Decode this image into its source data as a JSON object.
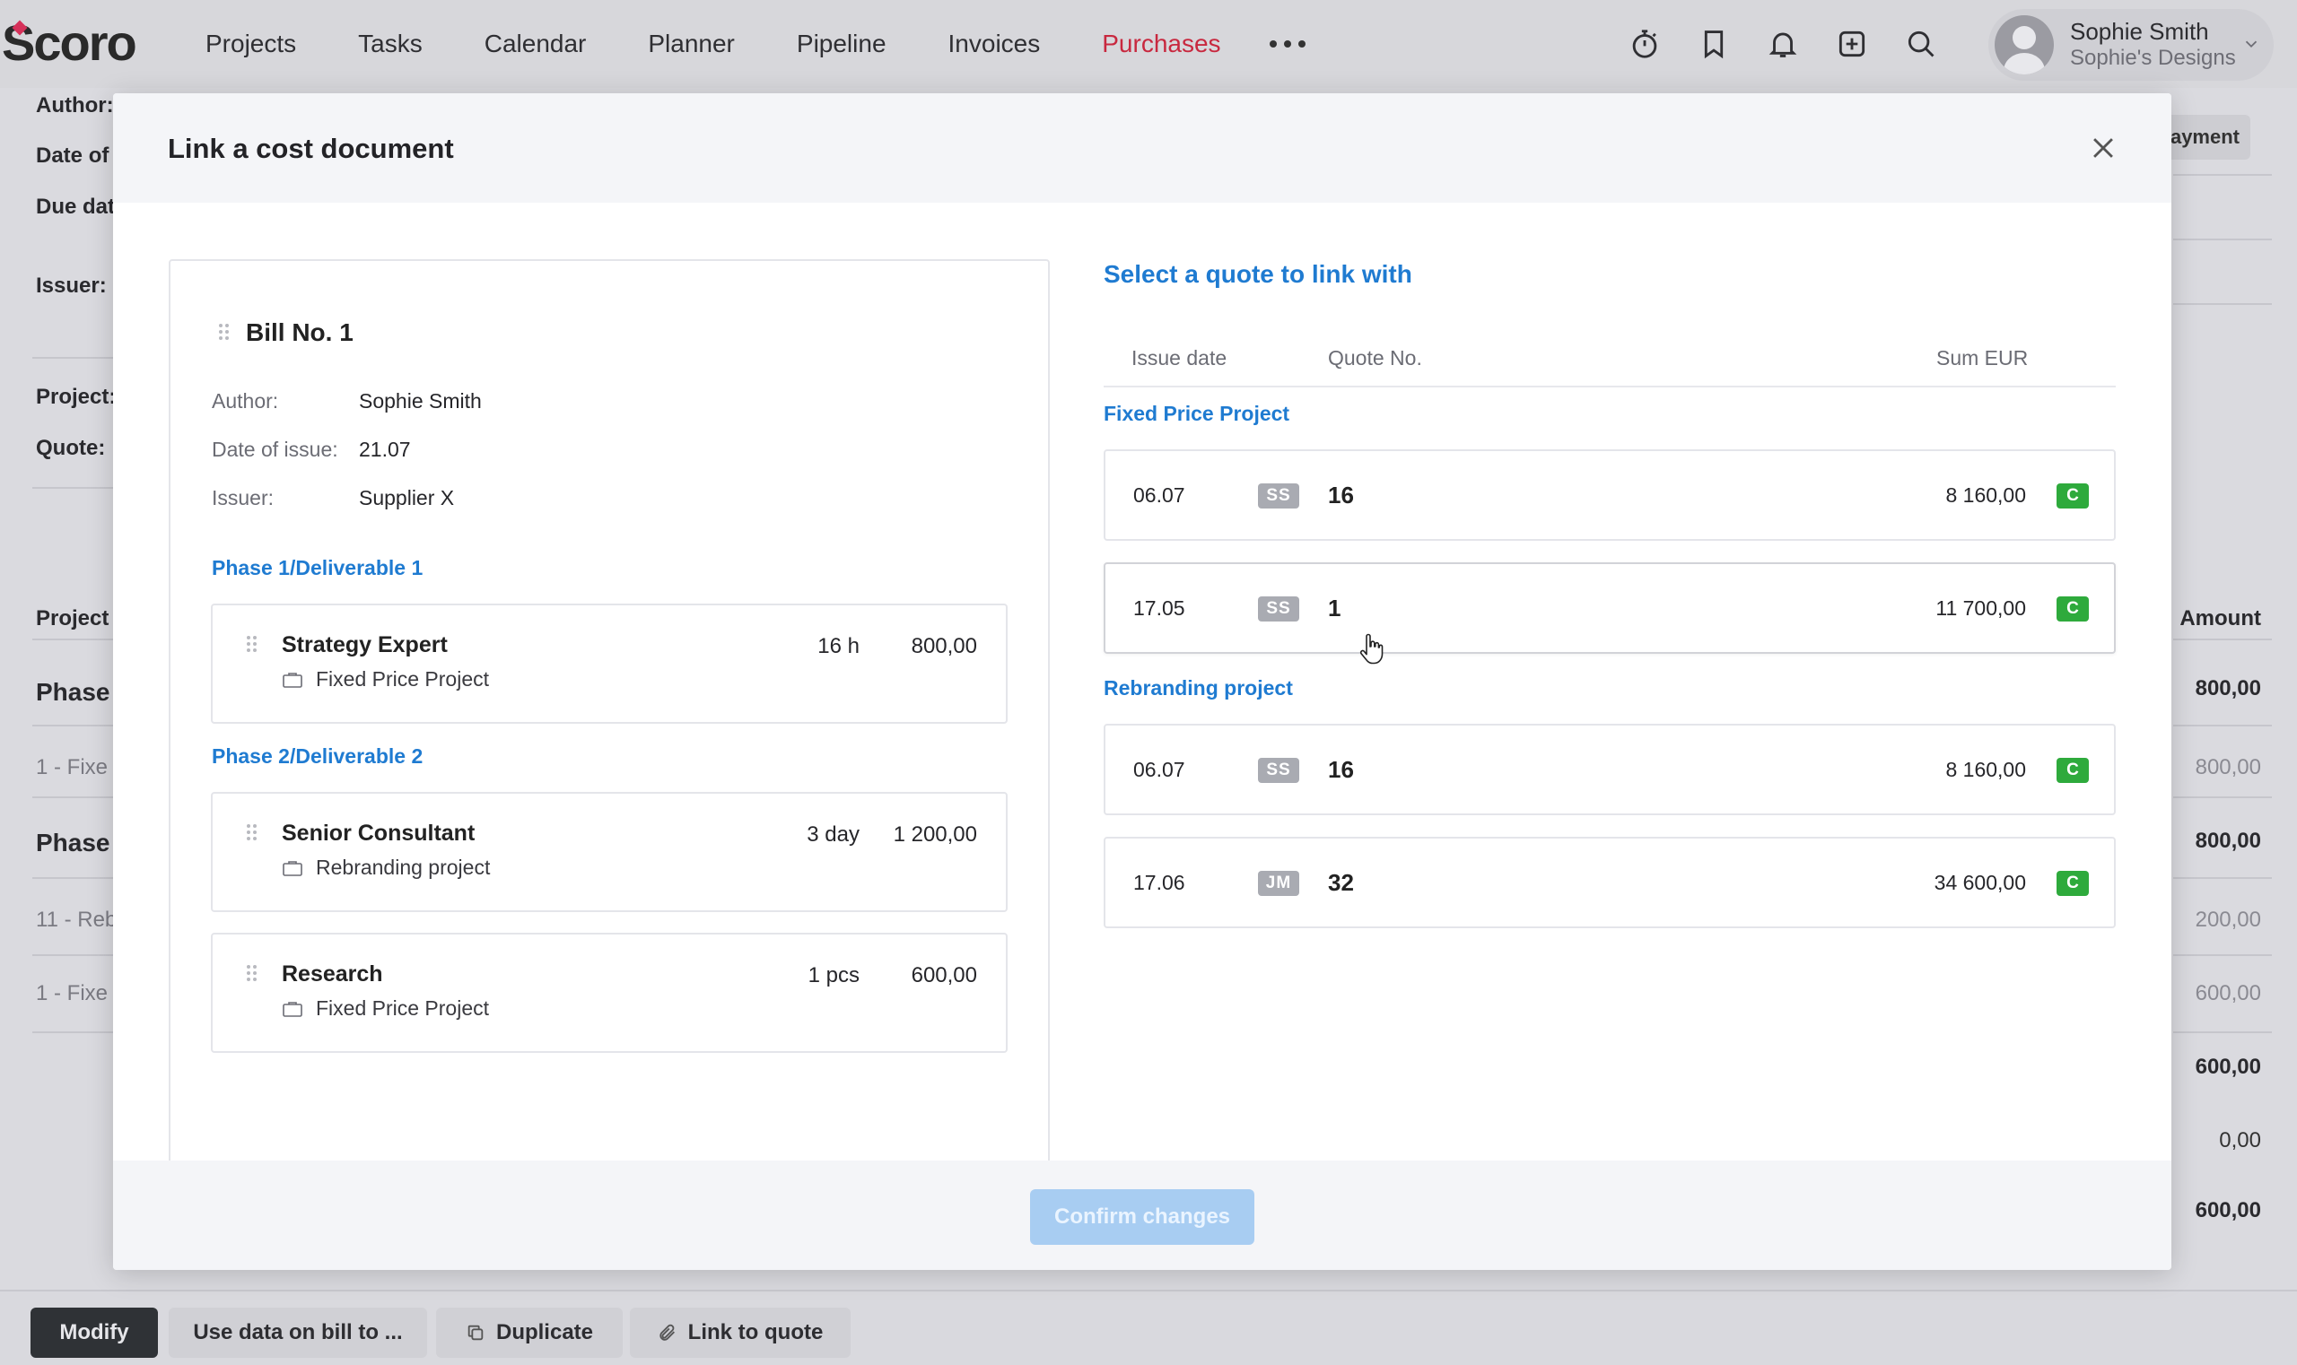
{
  "app": {
    "brand": "Scoro",
    "nav": [
      "Projects",
      "Tasks",
      "Calendar",
      "Planner",
      "Pipeline",
      "Invoices",
      "Purchases"
    ],
    "active_nav": "Purchases",
    "more_icon": "ellipsis-icon",
    "tool_icons": [
      "timer-icon",
      "bookmark-icon",
      "bell-icon",
      "add-icon",
      "search-icon"
    ],
    "user": {
      "name": "Sophie Smith",
      "company": "Sophie's Designs"
    }
  },
  "background": {
    "labels": [
      "Author:",
      "Date of",
      "Due dat",
      "Issuer:",
      "Project:",
      "Quote:"
    ],
    "chip": "Payment",
    "table_header_left": "Project",
    "table_header_right": "Amount",
    "rows": [
      {
        "left": "Phase",
        "right": "800,00",
        "section": true
      },
      {
        "left": "1 - Fixe",
        "right": "800,00",
        "section": false
      },
      {
        "left": "Phase",
        "right": "800,00",
        "section": true
      },
      {
        "left": "11 - Reb",
        "right": "200,00",
        "section": false
      },
      {
        "left": "1 - Fixe",
        "right": "600,00",
        "section": false
      }
    ],
    "totals": [
      "600,00",
      "0,00",
      "600,00"
    ]
  },
  "modal": {
    "title": "Link a cost document",
    "confirm_label": "Confirm changes",
    "bill": {
      "title": "Bill No. 1",
      "meta": [
        {
          "key": "Author:",
          "value": "Sophie Smith"
        },
        {
          "key": "Date of issue:",
          "value": "21.07"
        },
        {
          "key": "Issuer:",
          "value": "Supplier X"
        }
      ],
      "phases": [
        {
          "name": "Phase 1/Deliverable 1",
          "lines": [
            {
              "name": "Strategy Expert",
              "qty": "16 h",
              "sum": "800,00",
              "project": "Fixed Price Project"
            }
          ]
        },
        {
          "name": "Phase 2/Deliverable 2",
          "lines": [
            {
              "name": "Senior Consultant",
              "qty": "3 day",
              "sum": "1 200,00",
              "project": "Rebranding project"
            },
            {
              "name": "Research",
              "qty": "1 pcs",
              "sum": "600,00",
              "project": "Fixed Price Project"
            }
          ]
        }
      ]
    },
    "quotes": {
      "title": "Select a quote to link with",
      "columns": {
        "date": "Issue date",
        "number": "Quote No.",
        "sum": "Sum EUR"
      },
      "groups": [
        {
          "name": "Fixed Price Project",
          "rows": [
            {
              "date": "06.07",
              "initials": "SS",
              "number": "16",
              "sum": "8 160,00",
              "status": "C"
            },
            {
              "date": "17.05",
              "initials": "SS",
              "number": "1",
              "sum": "11 700,00",
              "status": "C"
            }
          ]
        },
        {
          "name": "Rebranding project",
          "rows": [
            {
              "date": "06.07",
              "initials": "SS",
              "number": "16",
              "sum": "8 160,00",
              "status": "C"
            },
            {
              "date": "17.06",
              "initials": "JM",
              "number": "32",
              "sum": "34 600,00",
              "status": "C"
            }
          ]
        }
      ]
    }
  },
  "bottom_bar": {
    "modify": "Modify",
    "use_data": "Use data on bill to ...",
    "duplicate": "Duplicate",
    "link_to_quote": "Link to quote"
  },
  "colors": {
    "accent_blue": "#1f7bd1",
    "active_nav_red": "#c8283f",
    "status_green": "#2eaa3c",
    "confirm_disabled": "#a8cdf2"
  }
}
